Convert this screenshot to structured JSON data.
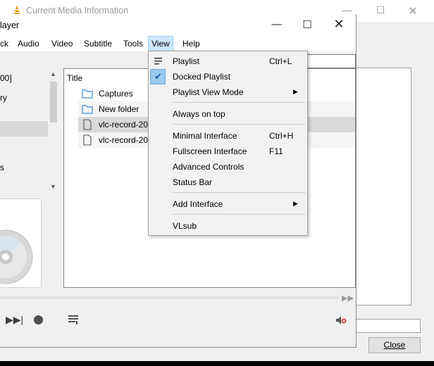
{
  "background_dialog": {
    "title": "Current Media Information",
    "close_button": "Close"
  },
  "vlc": {
    "title": "layer",
    "menu": [
      "ck",
      "Audio",
      "Video",
      "Subtitle",
      "Tools",
      "View",
      "Help"
    ],
    "active_menu": "View",
    "sidebar": [
      {
        "label": "00]"
      },
      {
        "label": "ry"
      },
      {
        "label": "s"
      }
    ],
    "playlist": {
      "column_title": "Title",
      "rows": [
        {
          "label": "Captures",
          "kind": "folder"
        },
        {
          "label": "New folder",
          "kind": "folder"
        },
        {
          "label": "vlc-record-202",
          "kind": "file"
        },
        {
          "label": "vlc-record-202",
          "kind": "file"
        }
      ]
    }
  },
  "view_menu": {
    "items": [
      {
        "label": "Playlist",
        "shortcut": "Ctrl+L",
        "icon": "playlist-icon"
      },
      {
        "label": "Docked Playlist",
        "checked": true
      },
      {
        "label": "Playlist View Mode",
        "submenu": true
      },
      {
        "label": "Always on top"
      },
      {
        "label": "Minimal Interface",
        "shortcut": "Ctrl+H"
      },
      {
        "label": "Fullscreen Interface",
        "shortcut": "F11"
      },
      {
        "label": "Advanced Controls"
      },
      {
        "label": "Status Bar"
      },
      {
        "label": "Add Interface",
        "submenu": true
      },
      {
        "label": "VLsub"
      }
    ]
  },
  "colors": {
    "menu_highlight": "#cce8ff",
    "check_highlight": "#99c9ef",
    "folder": "#3b8ed6",
    "vlc_orange": "#f08c00"
  }
}
